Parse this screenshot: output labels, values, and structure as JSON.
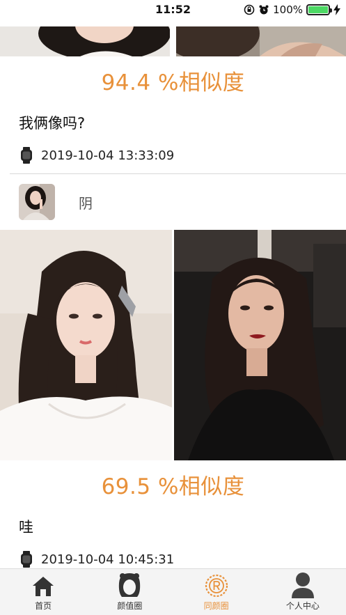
{
  "status_bar": {
    "time": "11:52",
    "battery_percent": "100%",
    "battery_level": 1.0
  },
  "posts": [
    {
      "similarity": "94.4 %相似度",
      "caption": "我俩像吗?",
      "date": "2019-10-04 13:33:09"
    },
    {
      "username": "阴",
      "similarity": "69.5 %相似度",
      "caption": "哇",
      "date": "2019-10-04 10:45:31"
    }
  ],
  "tabs": [
    {
      "label": "首页",
      "icon": "home-icon"
    },
    {
      "label": "颜值圈",
      "icon": "hair-face-icon"
    },
    {
      "label": "同颜圈",
      "icon": "registered-circle-icon",
      "active": true
    },
    {
      "label": "个人中心",
      "icon": "person-icon"
    }
  ],
  "colors": {
    "accent": "#e8913a",
    "battery": "#4cd964"
  }
}
